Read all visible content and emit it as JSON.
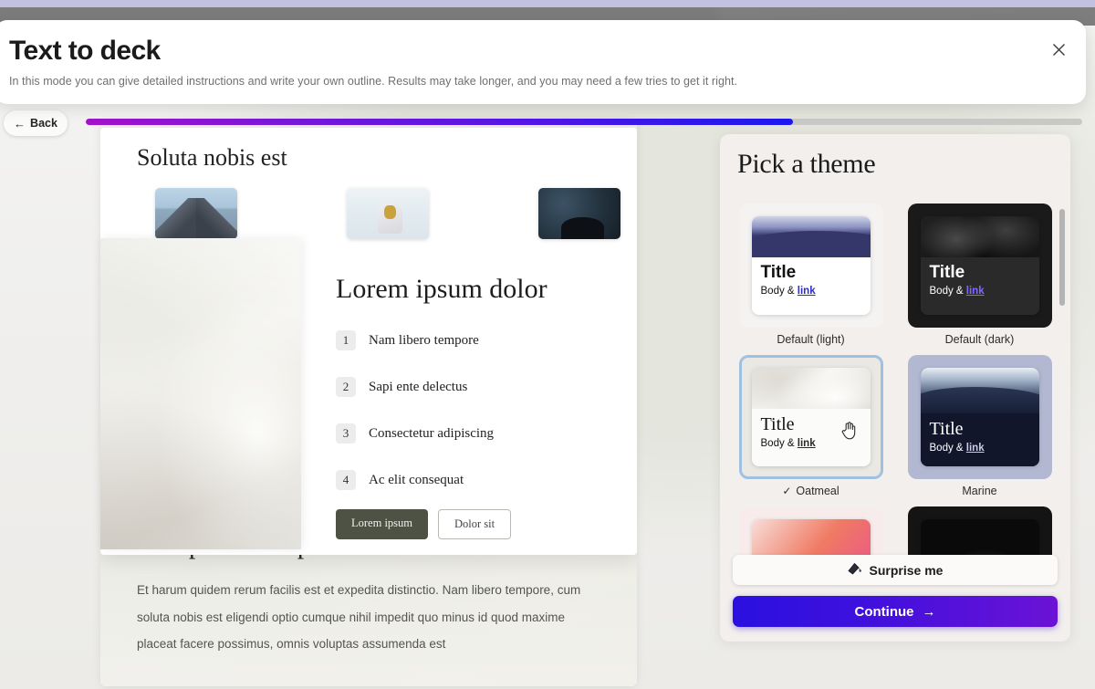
{
  "modal": {
    "title": "Text to deck",
    "subtitle": "In this mode you can give detailed instructions and write your own outline. Results may take longer, and you may need a few tries to get it right.",
    "close_label": "×"
  },
  "nav": {
    "back_label": "Back",
    "back_arrow": "←",
    "progress_percent": 71
  },
  "preview": {
    "front_slide": {
      "title": "Soluta nobis est",
      "heading": "Lorem ipsum dolor",
      "list": [
        {
          "number": "1",
          "text": "Nam libero tempore"
        },
        {
          "number": "2",
          "text": "Sapi ente delectus"
        },
        {
          "number": "3",
          "text": "Consectetur adipiscing"
        },
        {
          "number": "4",
          "text": "Ac elit consequat"
        }
      ],
      "primary_button": "Lorem ipsum",
      "secondary_button": "Dolor sit",
      "images": [
        "mountain-photo",
        "hiker-photo",
        "starry-night-photo"
      ]
    },
    "back_slide": {
      "title": "Voluptas sit aspernatur",
      "body": "Et harum quidem rerum facilis est et expedita distinctio. Nam libero tempore, cum soluta nobis est eligendi optio cumque nihil impedit quo minus id quod maxime placeat facere possimus, omnis voluptas assumenda est"
    }
  },
  "theme_panel": {
    "title": "Pick a theme",
    "card_sample": {
      "title": "Title",
      "body_prefix": "Body & ",
      "link": "link"
    },
    "themes": [
      {
        "name": "Default (light)",
        "key": "default-light",
        "selected": false,
        "variant": "card-light"
      },
      {
        "name": "Default (dark)",
        "key": "default-dark",
        "selected": false,
        "variant": "card-dark"
      },
      {
        "name": "Oatmeal",
        "key": "oatmeal",
        "selected": true,
        "variant": "card-oatmeal"
      },
      {
        "name": "Marine",
        "key": "marine",
        "selected": false,
        "variant": "card-marine"
      }
    ],
    "partial_themes": [
      {
        "key": "coral",
        "variant": "card-coral"
      },
      {
        "key": "dark-2",
        "variant": "card-dark2"
      }
    ],
    "selected_check": "✓",
    "surprise_label": "Surprise me",
    "surprise_icon": "palette-icon",
    "continue_label": "Continue",
    "continue_arrow": "→"
  },
  "colors": {
    "accent_purple": "#4f16e0",
    "progress_start": "#a312cc",
    "progress_end": "#1d19ef",
    "panel_bg": "#f2efed",
    "selected_border": "#9fc0e0"
  }
}
